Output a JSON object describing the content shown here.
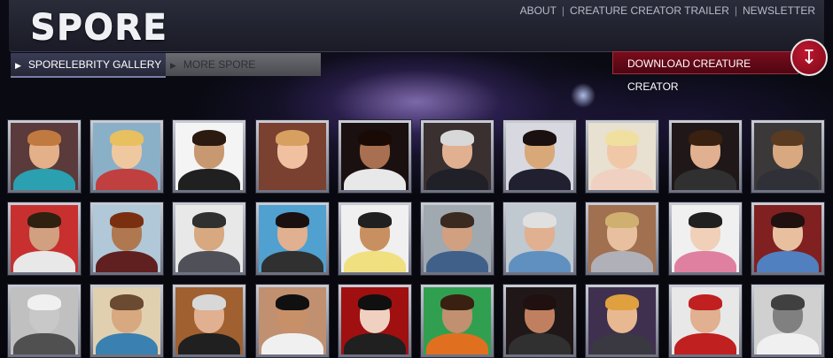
{
  "brand": {
    "logo_text": "SPORE"
  },
  "top_nav": {
    "about": "ABOUT",
    "trailer": "CREATURE CREATOR TRAILER",
    "newsletter": "NEWSLETTER",
    "separator": "|"
  },
  "tabs": {
    "gallery": "SPORELEBRITY GALLERY",
    "more": "MORE SPORE"
  },
  "download": {
    "label": "DOWNLOAD CREATURE CREATOR",
    "icon": "download-arrow-icon",
    "color": "#7a0c1c"
  },
  "gallery": {
    "rows": [
      [
        {
          "bg": "#5a3a3a",
          "skin": "#e3b08a",
          "hair": "#c07a40",
          "shirt": "#2aa0b0"
        },
        {
          "bg": "#8ab0c8",
          "skin": "#f0c8a0",
          "hair": "#e8c060",
          "shirt": "#c04040"
        },
        {
          "bg": "#f4f4f4",
          "skin": "#c89870",
          "hair": "#2a1a10",
          "shirt": "#202020"
        },
        {
          "bg": "#7a4030",
          "skin": "#f0c0a0",
          "hair": "#d8a060",
          "shirt": "#7a4030"
        },
        {
          "bg": "#1a1010",
          "skin": "#a87050",
          "hair": "#1a0a05",
          "shirt": "#e8e8e8"
        },
        {
          "bg": "#3a3030",
          "skin": "#e0b090",
          "hair": "#d8d8d8",
          "shirt": "#202028"
        },
        {
          "bg": "#d8d8e0",
          "skin": "#d8a878",
          "hair": "#1a1010",
          "shirt": "#202030"
        },
        {
          "bg": "#e8e0d0",
          "skin": "#f0c8a8",
          "hair": "#f0e0a0",
          "shirt": "#f0d0c0"
        },
        {
          "bg": "#201818",
          "skin": "#e0b090",
          "hair": "#3a2010",
          "shirt": "#303030"
        },
        {
          "bg": "#3a3838",
          "skin": "#d8a880",
          "hair": "#5a3a20",
          "shirt": "#303038"
        }
      ],
      [
        {
          "bg": "#c83030",
          "skin": "#d0a080",
          "hair": "#302010",
          "shirt": "#e8e8e8"
        },
        {
          "bg": "#b0c8d8",
          "skin": "#b07850",
          "hair": "#7a3010",
          "shirt": "#602020"
        },
        {
          "bg": "#e8e8e8",
          "skin": "#d8a880",
          "hair": "#303030",
          "shirt": "#505058"
        },
        {
          "bg": "#50a0d0",
          "skin": "#e0b090",
          "hair": "#1a1010",
          "shirt": "#303030"
        },
        {
          "bg": "#f0f0f0",
          "skin": "#c89060",
          "hair": "#202020",
          "shirt": "#f0e080"
        },
        {
          "bg": "#a0a8b0",
          "skin": "#d0a080",
          "hair": "#3a2a20",
          "shirt": "#40608a"
        },
        {
          "bg": "#c0c8d0",
          "skin": "#e0b090",
          "hair": "#e0e0e0",
          "shirt": "#6090c0"
        },
        {
          "bg": "#a07050",
          "skin": "#e8c0a0",
          "hair": "#d0b070",
          "shirt": "#b0b0b8"
        },
        {
          "bg": "#f0f0f0",
          "skin": "#f0d0b8",
          "hair": "#202020",
          "shirt": "#e080a0"
        },
        {
          "bg": "#802020",
          "skin": "#e8c0a0",
          "hair": "#201010",
          "shirt": "#5080c0"
        }
      ],
      [
        {
          "bg": "#c0c0c0",
          "skin": "#c8c8c8",
          "hair": "#f0f0f0",
          "shirt": "#505050"
        },
        {
          "bg": "#e0d0b0",
          "skin": "#d8a880",
          "hair": "#6a4a30",
          "shirt": "#3a80b0"
        },
        {
          "bg": "#a06030",
          "skin": "#e0b090",
          "hair": "#d8d8d8",
          "shirt": "#202020"
        },
        {
          "bg": "#c09070",
          "skin": "#c89068",
          "hair": "#101010",
          "shirt": "#f0f0f0"
        },
        {
          "bg": "#a01010",
          "skin": "#f0d0c0",
          "hair": "#101010",
          "shirt": "#202020"
        },
        {
          "bg": "#30a050",
          "skin": "#c09070",
          "hair": "#3a2010",
          "shirt": "#e07020"
        },
        {
          "bg": "#201818",
          "skin": "#c08060",
          "hair": "#201010",
          "shirt": "#303030"
        },
        {
          "bg": "#403050",
          "skin": "#e8b890",
          "hair": "#e0a040",
          "shirt": "#3a3840"
        },
        {
          "bg": "#e8e8e8",
          "skin": "#e0b090",
          "hair": "#c02020",
          "shirt": "#c02020"
        },
        {
          "bg": "#d0d0d0",
          "skin": "#808080",
          "hair": "#404040",
          "shirt": "#f0f0f0"
        }
      ]
    ]
  }
}
